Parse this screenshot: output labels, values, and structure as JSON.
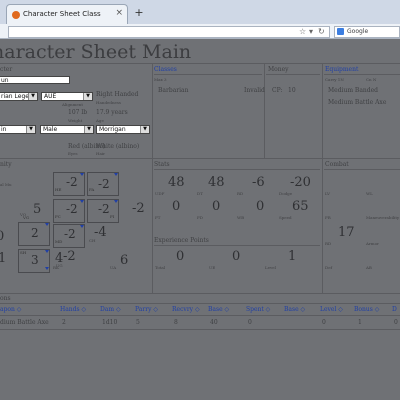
{
  "browser": {
    "tab_title": "Character Sheet Class",
    "tab_close": "×",
    "new_tab": "+",
    "search_placeholder": "Google",
    "nav_icons": {
      "star": "☆",
      "reload": "↻",
      "dropdown": "▾"
    }
  },
  "page": {
    "title": "haracter Sheet Main"
  },
  "character": {
    "section_label": "cter",
    "name_value": "un",
    "race_value": "rian Legend",
    "alignment_value": "AUE",
    "handedness": "Right Handed",
    "handedness_label": "Handedness",
    "weight": "107 lb",
    "weight_label": "Weight",
    "age": "17.9 years",
    "age_label": "Age",
    "skill_label": "Alignment",
    "gender_select": "Male",
    "culture_select": "Morrigan",
    "left_select": "in",
    "eyes": "Red (albino)",
    "eyes_label": "Eyes",
    "hair": "White (albino)",
    "hair_label": "Hair"
  },
  "classes": {
    "title": "Classes",
    "col": "Max 3",
    "class_name": "Barbarian",
    "class_status": "Invalid"
  },
  "money": {
    "title": "Money",
    "label": "CP:",
    "value": "10"
  },
  "equipment": {
    "title": "Equipment",
    "col1": "Carry 1N",
    "col2": "Cn N",
    "items": [
      "Medium Banded",
      "Medium Battle Axe"
    ]
  },
  "body": {
    "section_label": "nity",
    "sub_label": "al Mu",
    "boxes": [
      {
        "name": "HE",
        "value": "-2"
      },
      {
        "name": "FA",
        "value": "-2"
      },
      {
        "name": "FC",
        "value": "-2"
      },
      {
        "name": "FI",
        "value": "-2"
      },
      {
        "name": "VG",
        "value": "2"
      },
      {
        "name": "MD",
        "value": "-2"
      },
      {
        "name": "SH",
        "value": "3"
      }
    ],
    "loose": [
      {
        "label": "VO",
        "value": "5"
      },
      {
        "label": "UG",
        "value": "-2"
      },
      {
        "label": "",
        "value": "0"
      },
      {
        "label": "",
        "value": "1"
      },
      {
        "label": "CH",
        "value": "-4"
      },
      {
        "label": "RK",
        "value": "4"
      },
      {
        "label": "UA",
        "value": "6"
      },
      {
        "label": "",
        "value": "-2"
      }
    ]
  },
  "stats": {
    "title": "Stats",
    "row1": [
      {
        "value": "48",
        "label": "UDF"
      },
      {
        "value": "48",
        "label": "DT"
      },
      {
        "value": "-6",
        "label": "RD"
      },
      {
        "value": "-20",
        "label": "Dodge"
      }
    ],
    "row2": [
      {
        "value": "0",
        "label": "FT"
      },
      {
        "value": "0",
        "label": "FD"
      },
      {
        "value": "0",
        "label": "WB"
      },
      {
        "value": "65",
        "label": "Speed"
      }
    ]
  },
  "experience": {
    "title": "Experience Points",
    "values": [
      {
        "value": "0",
        "label": "Total"
      },
      {
        "value": "0",
        "label": "UE"
      },
      {
        "value": "1",
        "label": "Level"
      }
    ]
  },
  "combat": {
    "title": "Combat",
    "labels": [
      "LV",
      "WL",
      "FR",
      "Maneuverability",
      "RD",
      "Armor",
      "Def",
      "AB"
    ],
    "value": "17"
  },
  "weapons": {
    "section_label": "ons",
    "headers": [
      "apon ◇",
      "Hands ◇",
      "Dam ◇",
      "Parry ◇",
      "Recvry ◇",
      "Base ◇",
      "Spent ◇",
      "Base ◇",
      "Level ◇",
      "Bonus ◇",
      "D"
    ],
    "row": [
      "dium Battle Axe",
      "2",
      "1d10",
      "5",
      "8",
      "40",
      "0",
      "",
      "0",
      "1",
      "0"
    ]
  }
}
